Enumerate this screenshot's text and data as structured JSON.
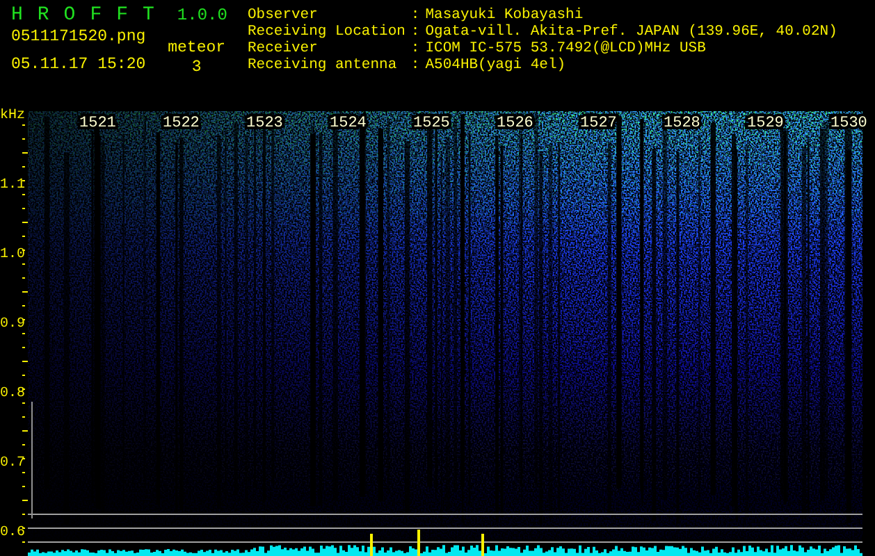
{
  "app": {
    "name": "HROFFT",
    "version": "1.0.0"
  },
  "file": {
    "filename": "0511171520.png",
    "datetime": "05.11.17 15:20"
  },
  "meteor": {
    "label": "meteor",
    "count": "3"
  },
  "station": [
    {
      "label": "Observer",
      "separator": ":",
      "value": "Masayuki Kobayashi"
    },
    {
      "label": "Receiving Location",
      "separator": ":",
      "value": "Ogata-vill. Akita-Pref. JAPAN (139.96E, 40.02N)"
    },
    {
      "label": "Receiver",
      "separator": ":",
      "value": "ICOM IC-575 53.7492(@LCD)MHz USB"
    },
    {
      "label": "Receiving antenna",
      "separator": ":",
      "value": "A504HB(yagi 4el)"
    }
  ],
  "spectrogram": {
    "unit": "kHz",
    "frequency_labels": [
      "1.1",
      "1.0",
      "0.9",
      "0.8",
      "0.7",
      "0.6"
    ],
    "time_labels": [
      "1521",
      "1522",
      "1523",
      "1524",
      "1525",
      "1526",
      "1527",
      "1528",
      "1529",
      "1530"
    ]
  }
}
